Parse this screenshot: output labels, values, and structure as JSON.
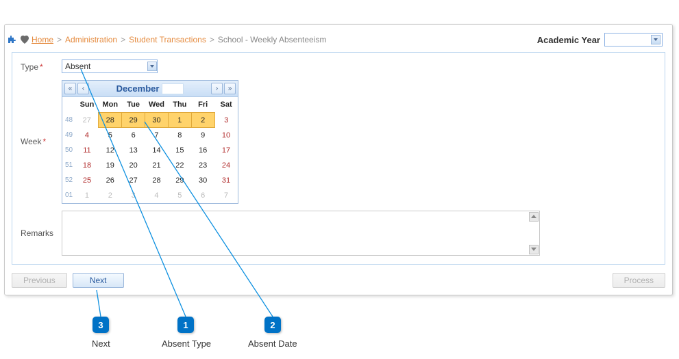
{
  "breadcrumb": {
    "home": "Home",
    "administration": "Administration",
    "student_transactions": "Student Transactions",
    "current": "School - Weekly Absenteeism",
    "sep": ">"
  },
  "academic_year": {
    "label": "Academic Year",
    "value": ""
  },
  "form": {
    "type_label": "Type",
    "type_value": "Absent",
    "week_label": "Week",
    "remarks_label": "Remarks",
    "remarks_value": ""
  },
  "calendar": {
    "month_label": "December",
    "year_value": "",
    "day_headers": [
      "Sun",
      "Mon",
      "Tue",
      "Wed",
      "Thu",
      "Fri",
      "Sat"
    ],
    "weeks": [
      {
        "wk": "48",
        "days": [
          {
            "d": "27",
            "cls": "other"
          },
          {
            "d": "28",
            "cls": "hl"
          },
          {
            "d": "29",
            "cls": "hl"
          },
          {
            "d": "30",
            "cls": "hl"
          },
          {
            "d": "1",
            "cls": "hl"
          },
          {
            "d": "2",
            "cls": "hl"
          },
          {
            "d": "3",
            "cls": "sat"
          }
        ]
      },
      {
        "wk": "49",
        "days": [
          {
            "d": "4",
            "cls": "sun"
          },
          {
            "d": "5",
            "cls": ""
          },
          {
            "d": "6",
            "cls": ""
          },
          {
            "d": "7",
            "cls": ""
          },
          {
            "d": "8",
            "cls": ""
          },
          {
            "d": "9",
            "cls": ""
          },
          {
            "d": "10",
            "cls": "sat"
          }
        ]
      },
      {
        "wk": "50",
        "days": [
          {
            "d": "11",
            "cls": "sun"
          },
          {
            "d": "12",
            "cls": ""
          },
          {
            "d": "13",
            "cls": ""
          },
          {
            "d": "14",
            "cls": ""
          },
          {
            "d": "15",
            "cls": ""
          },
          {
            "d": "16",
            "cls": ""
          },
          {
            "d": "17",
            "cls": "sat"
          }
        ]
      },
      {
        "wk": "51",
        "days": [
          {
            "d": "18",
            "cls": "sun"
          },
          {
            "d": "19",
            "cls": ""
          },
          {
            "d": "20",
            "cls": ""
          },
          {
            "d": "21",
            "cls": ""
          },
          {
            "d": "22",
            "cls": ""
          },
          {
            "d": "23",
            "cls": ""
          },
          {
            "d": "24",
            "cls": "sat"
          }
        ]
      },
      {
        "wk": "52",
        "days": [
          {
            "d": "25",
            "cls": "sun"
          },
          {
            "d": "26",
            "cls": ""
          },
          {
            "d": "27",
            "cls": ""
          },
          {
            "d": "28",
            "cls": ""
          },
          {
            "d": "29",
            "cls": ""
          },
          {
            "d": "30",
            "cls": ""
          },
          {
            "d": "31",
            "cls": "sat"
          }
        ]
      },
      {
        "wk": "01",
        "days": [
          {
            "d": "1",
            "cls": "other"
          },
          {
            "d": "2",
            "cls": "other"
          },
          {
            "d": "3",
            "cls": "other"
          },
          {
            "d": "4",
            "cls": "other"
          },
          {
            "d": "5",
            "cls": "other"
          },
          {
            "d": "6",
            "cls": "other"
          },
          {
            "d": "7",
            "cls": "other"
          }
        ]
      }
    ]
  },
  "buttons": {
    "previous": "Previous",
    "next": "Next",
    "process": "Process"
  },
  "annotations": {
    "b1": "1",
    "b2": "2",
    "b3": "3",
    "l1": "Absent Type",
    "l2": "Absent Date",
    "l3": "Next"
  }
}
